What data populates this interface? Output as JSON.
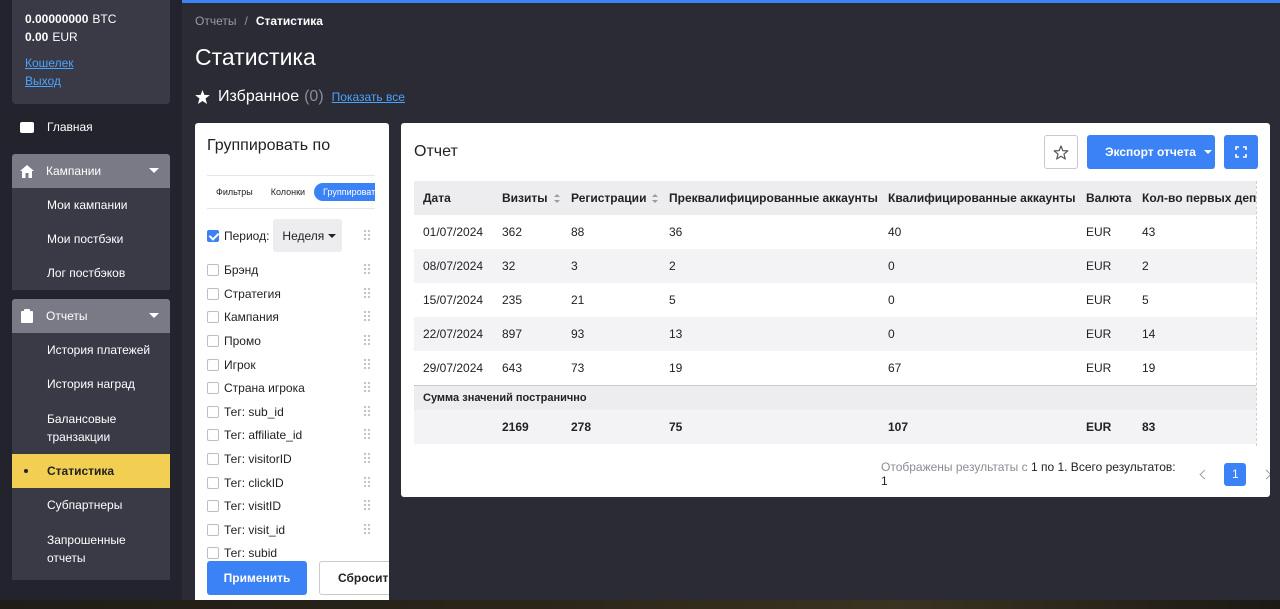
{
  "wallet": {
    "btc_amount": "0.00000000",
    "btc_currency": "BTC",
    "eur_amount": "0.00",
    "eur_currency": "EUR",
    "wallet_link": "Кошелек",
    "logout_link": "Выход"
  },
  "sidebar": {
    "home": "Главная",
    "campaigns": {
      "label": "Кампании",
      "items": [
        "Мои кампании",
        "Мои постбэки",
        "Лог постбэков"
      ]
    },
    "reports": {
      "label": "Отчеты",
      "items": [
        "История платежей",
        "История наград",
        "Балансовые транзакции",
        "Статистика",
        "Субпартнеры",
        "Запрошенные отчеты"
      ]
    }
  },
  "breadcrumb": {
    "parent": "Отчеты",
    "separator": "/",
    "current": "Статистика"
  },
  "page_title": "Статистика",
  "favorites": {
    "label": "Избранное",
    "count": "(0)",
    "show_all": "Показать все"
  },
  "group_by": {
    "title": "Группировать по",
    "tabs": [
      "Фильтры",
      "Колонки",
      "Группировать"
    ],
    "period_label": "Период:",
    "period_value": "Неделя",
    "options": [
      "Брэнд",
      "Стратегия",
      "Кампания",
      "Промо",
      "Игрок",
      "Страна игрока",
      "Тег: sub_id",
      "Тег: affiliate_id",
      "Тег: visitorID",
      "Тег: clickID",
      "Тег: visitID",
      "Тег: visit_id",
      "Тег: subid"
    ],
    "apply": "Применить",
    "reset": "Сбросить"
  },
  "report": {
    "title": "Отчет",
    "export": "Экспорт отчета",
    "columns": [
      "Дата",
      "Визиты",
      "Регистрации",
      "Преквалифицированные аккаунты",
      "Квалифицированные аккаунты",
      "Валюта",
      "Кол-во первых депозитов"
    ],
    "rows": [
      [
        "01/07/2024",
        "362",
        "88",
        "36",
        "40",
        "EUR",
        "43"
      ],
      [
        "08/07/2024",
        "32",
        "3",
        "2",
        "0",
        "EUR",
        "2"
      ],
      [
        "15/07/2024",
        "235",
        "21",
        "5",
        "0",
        "EUR",
        "5"
      ],
      [
        "22/07/2024",
        "897",
        "93",
        "13",
        "0",
        "EUR",
        "14"
      ],
      [
        "29/07/2024",
        "643",
        "73",
        "19",
        "67",
        "EUR",
        "19"
      ]
    ],
    "sum_label": "Сумма значений постранично",
    "sum_row": [
      "",
      "2169",
      "278",
      "75",
      "107",
      "EUR",
      "83"
    ],
    "pager_text_pre": "Отображены результаты с ",
    "pager_text_range": "1 по 1. Всего результатов: 1",
    "current_page": "1"
  },
  "colors": {
    "accent": "#3b82f6",
    "active_nav": "#f2cf52",
    "sidebar_bg": "#23232d",
    "content_bg": "#2b2b36"
  }
}
